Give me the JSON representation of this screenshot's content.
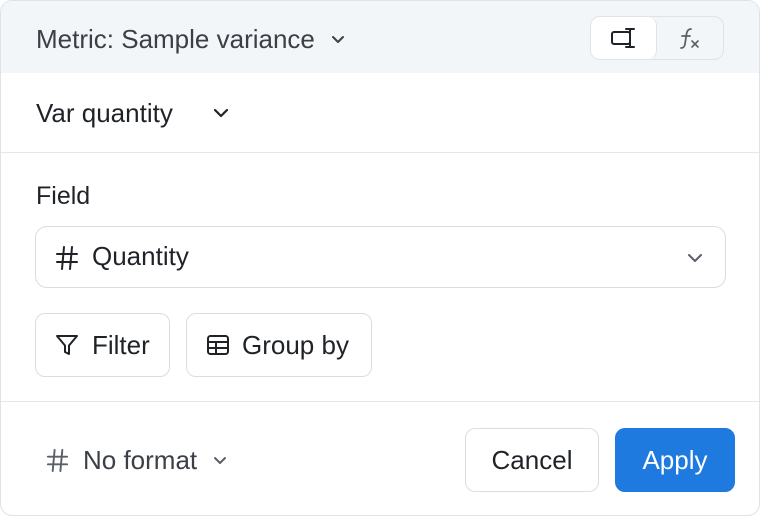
{
  "header": {
    "metric_label": "Metric: Sample variance",
    "metric_chevron_icon": "chevron-down-icon",
    "mode_toggle": [
      {
        "icon": "custom-column-icon",
        "active": true
      },
      {
        "icon": "function-fx-icon",
        "active": false
      }
    ]
  },
  "name": {
    "value": "Var quantity",
    "chevron_icon": "chevron-down-icon"
  },
  "field": {
    "label": "Field",
    "type_icon": "hash-icon",
    "value": "Quantity",
    "chevron_icon": "chevron-down-icon"
  },
  "actions": {
    "filter_label": "Filter",
    "filter_icon": "funnel-icon",
    "groupby_label": "Group by",
    "groupby_icon": "table-icon"
  },
  "footer": {
    "format_icon": "hash-icon",
    "format_label": "No format",
    "cancel_label": "Cancel",
    "apply_label": "Apply"
  },
  "colors": {
    "accent": "#1f7ae0",
    "header_bg": "#f3f6f9",
    "border": "#d9dde2",
    "text": "#1f2328",
    "muted_text": "#3b4046"
  }
}
